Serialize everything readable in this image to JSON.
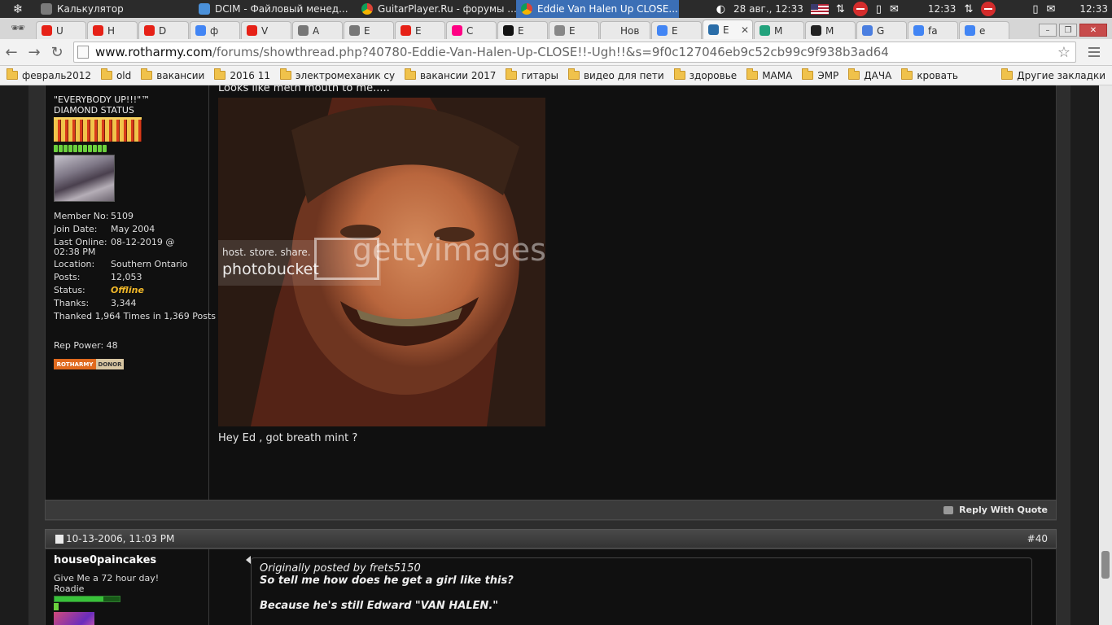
{
  "taskbar": {
    "tasks": [
      {
        "label": "Калькулятор",
        "icon": "calculator-icon",
        "active": false
      },
      {
        "label": "DCIM - Файловый менед...",
        "icon": "folder-icon",
        "active": false
      },
      {
        "label": "GuitarPlayer.Ru - форумы ...",
        "icon": "chrome-icon",
        "active": false
      },
      {
        "label": "Eddie Van Halen Up CLOSE...",
        "icon": "chrome-icon",
        "active": true
      }
    ],
    "date": "28 авг., 12:33",
    "clock_right": "12:33",
    "clock_far_right": "12:33"
  },
  "tabs": [
    {
      "label": "U",
      "fav": "youtube-icon"
    },
    {
      "label": "H",
      "fav": "youtube-icon"
    },
    {
      "label": "D",
      "fav": "youtube-icon"
    },
    {
      "label": "ф",
      "fav": "google-icon"
    },
    {
      "label": "V",
      "fav": "youtube-icon"
    },
    {
      "label": "A",
      "fav": "wikipedia-icon"
    },
    {
      "label": "E",
      "fav": "wikipedia-icon"
    },
    {
      "label": "E",
      "fav": "youtube-icon"
    },
    {
      "label": "C",
      "fav": "flickr-icon"
    },
    {
      "label": "E",
      "fav": "b-icon"
    },
    {
      "label": "E",
      "fav": "disc-icon"
    },
    {
      "label": "Нов",
      "fav": "none"
    },
    {
      "label": "E",
      "fav": "google-icon"
    },
    {
      "label": "E",
      "fav": "v-icon",
      "active": true
    },
    {
      "label": "M",
      "fav": "globe-icon"
    },
    {
      "label": "M",
      "fav": "eye-icon"
    },
    {
      "label": "G",
      "fav": "translate-icon"
    },
    {
      "label": "fa",
      "fav": "google-icon"
    },
    {
      "label": "e",
      "fav": "google-icon"
    }
  ],
  "omnibox": {
    "host": "www.rotharmy.com",
    "path": "/forums/showthread.php?40780-Eddie-Van-Halen-Up-CLOSE!!-Ugh!!&s=9f0c127046eb9c52cb99c9f938b3ad64"
  },
  "bookmarks": {
    "items": [
      "февраль2012",
      "old",
      "вакансии",
      "2016 11",
      "электромеханик су",
      "вакансии 2017",
      "гитары",
      "видео для пети",
      "здоровье",
      "МАМА",
      "ЭМР",
      "ДАЧА",
      "кровать"
    ],
    "other": "Другие закладки"
  },
  "post1": {
    "user_title": "\"EVERYBODY UP!!!\"™",
    "status_rank": "DIAMOND STATUS",
    "stats": [
      {
        "k": "Member No:",
        "v": "5109"
      },
      {
        "k": "Join Date:",
        "v": "May 2004"
      }
    ],
    "last_online_label": "Last Online:",
    "last_online_value": "08-12-2019 @",
    "last_online_time": "02:38 PM",
    "location_label": "Location:",
    "location_value": "Southern Ontario",
    "posts_label": "Posts:",
    "posts_value": "12,053",
    "status_label": "Status:",
    "status_value": "Offline",
    "thanks_label": "Thanks:",
    "thanks_value": "3,344",
    "thanked": "Thanked 1,964 Times in 1,369 Posts",
    "rep_power": "Rep Power:  48",
    "donor_left": "ROTHARMY",
    "donor_right": "DONOR",
    "message_top": "Looks like meth mouth to me.....",
    "watermark_small": "host. store. share.",
    "watermark_brand": "photobucket",
    "watermark_getty": "gettyimages",
    "caption": "Hey Ed , got breath mint ?",
    "reply_with_quote": "Reply With Quote"
  },
  "post2": {
    "date": "10-13-2006, 11:03 PM",
    "number": "#40",
    "username": "house0paincakes",
    "user_title": "Give Me a 72 hour day!",
    "rank": "Roadie",
    "quote_label": "Originally posted by frets5150",
    "quote_line1": "So tell me how does he get a girl like this?",
    "quote_line2": "Because he's still Edward \"VAN HALEN.\""
  },
  "colors": {
    "offline": "#f1b829",
    "taskbar_active": "#3b6fb6",
    "page_bg": "#101010"
  }
}
